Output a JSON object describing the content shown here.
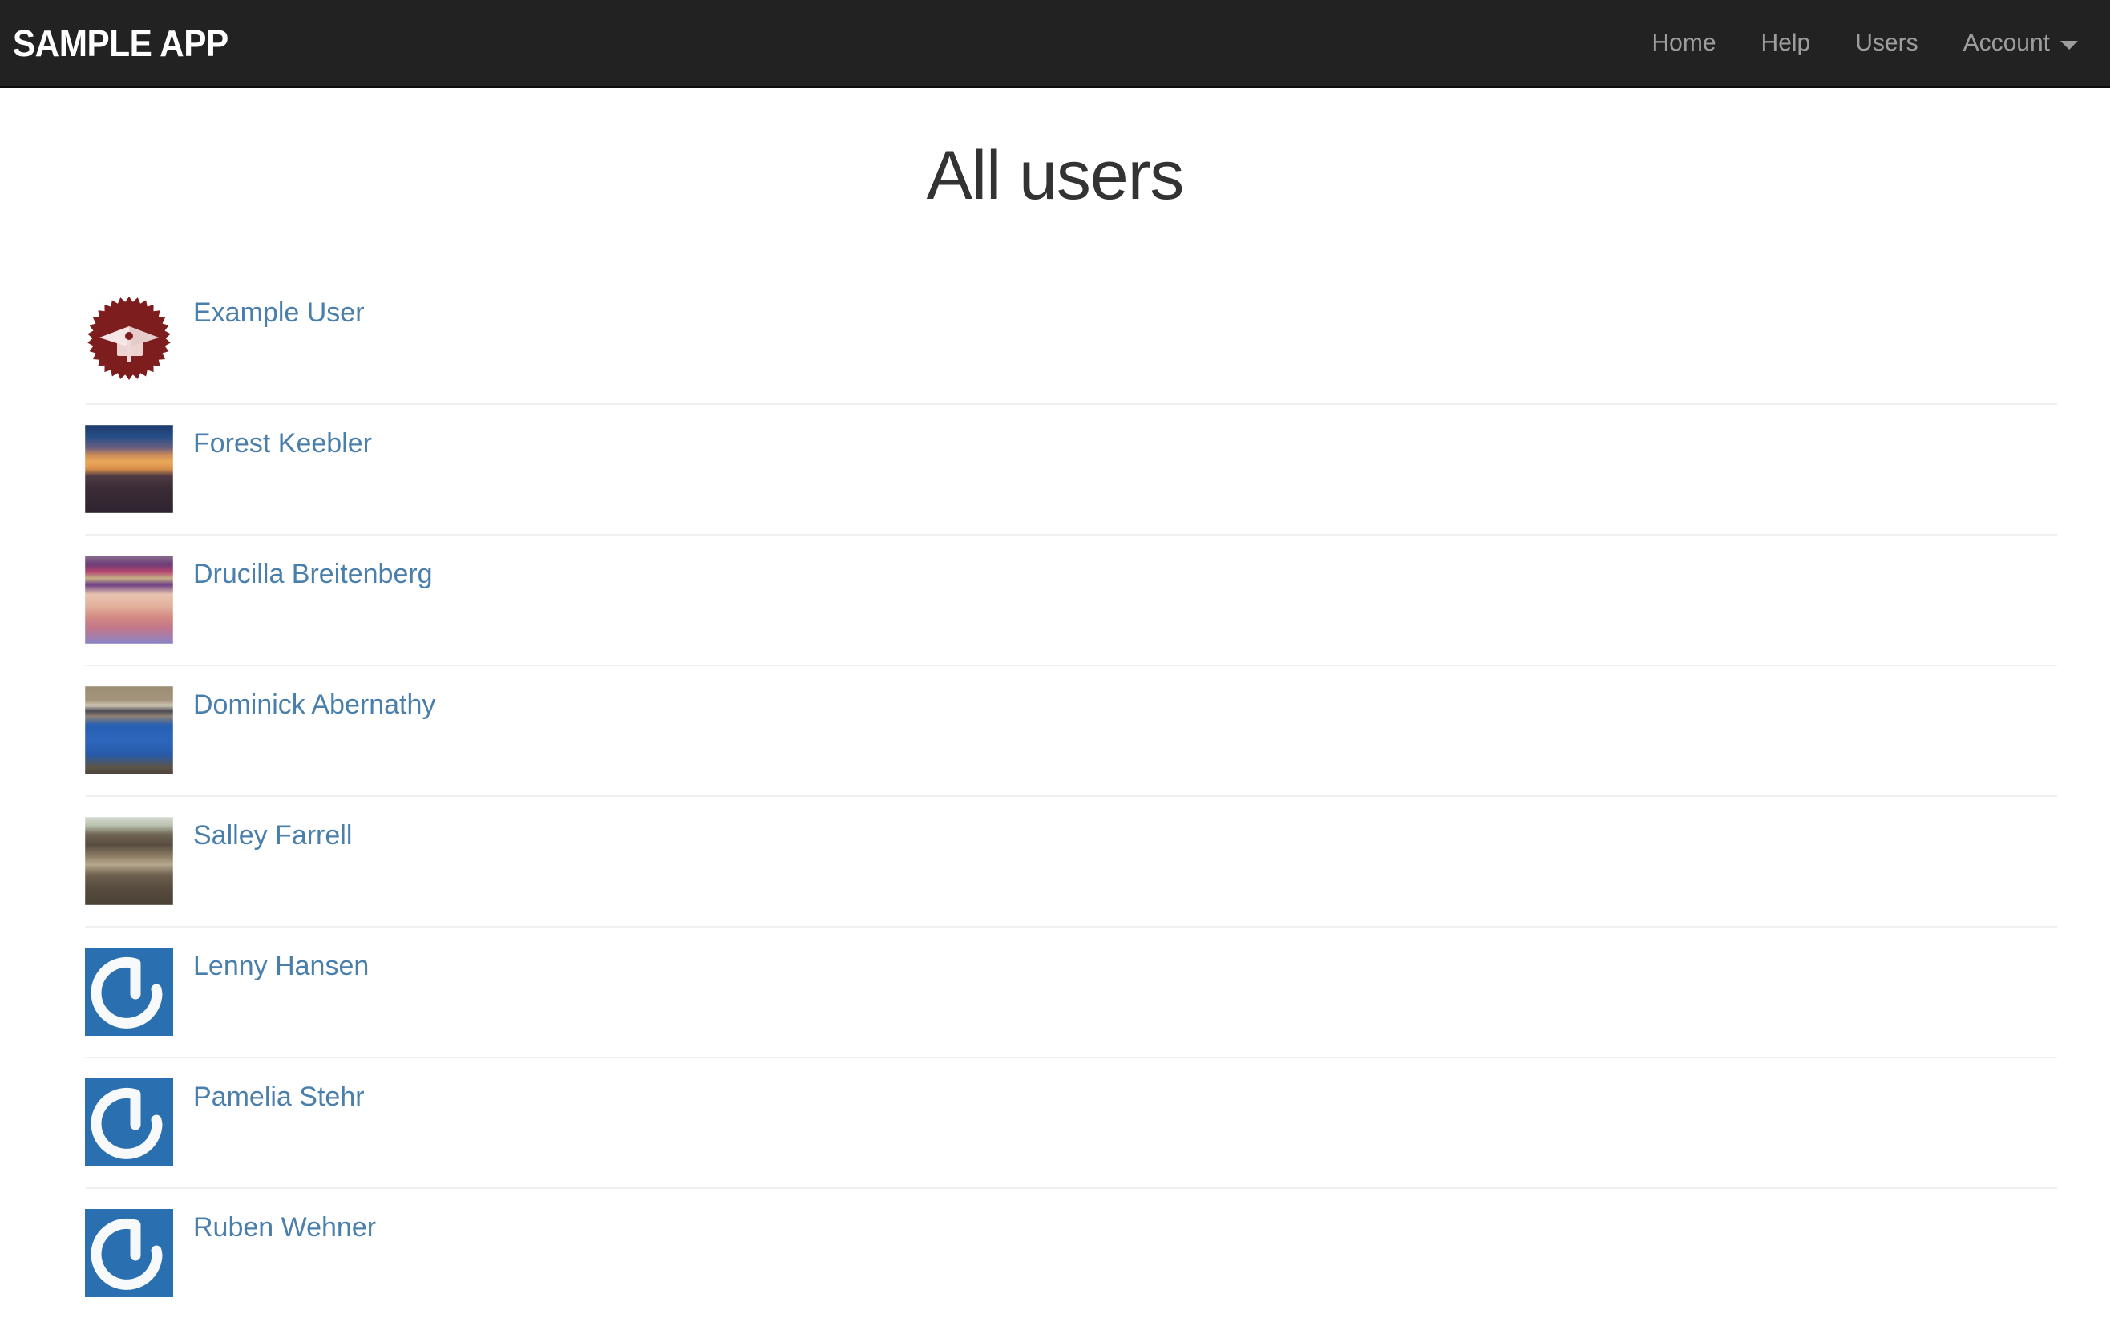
{
  "navbar": {
    "brand": "sample app",
    "links": [
      {
        "label": "Home",
        "name": "nav-link-home"
      },
      {
        "label": "Help",
        "name": "nav-link-help"
      },
      {
        "label": "Users",
        "name": "nav-link-users"
      }
    ],
    "account": {
      "label": "Account",
      "caret_icon": "chevron-down-icon"
    },
    "background_color": "#222222",
    "link_color": "#9d9d9d",
    "brand_color": "#ffffff"
  },
  "page": {
    "heading": "All users",
    "heading_color": "#333333",
    "link_color": "#4a7fac",
    "divider_color": "#f0f0f0"
  },
  "users": [
    {
      "name": "Example User",
      "avatar_icon": "graduation-cap-badge-avatar",
      "avatar_type": "rails-tutorial-badge"
    },
    {
      "name": "Forest Keebler",
      "avatar_icon": "sunset-landscape-photo-avatar",
      "avatar_type": "photo"
    },
    {
      "name": "Drucilla Breitenberg",
      "avatar_icon": "baby-in-knit-hat-photo-avatar",
      "avatar_type": "photo"
    },
    {
      "name": "Dominick Abernathy",
      "avatar_icon": "person-in-blue-shirt-photo-avatar",
      "avatar_type": "photo"
    },
    {
      "name": "Salley Farrell",
      "avatar_icon": "tabby-cat-photo-avatar",
      "avatar_type": "photo"
    },
    {
      "name": "Lenny Hansen",
      "avatar_icon": "gravatar-default-logo-avatar",
      "avatar_type": "gravatar-default"
    },
    {
      "name": "Pamelia Stehr",
      "avatar_icon": "gravatar-default-logo-avatar",
      "avatar_type": "gravatar-default"
    },
    {
      "name": "Ruben Wehner",
      "avatar_icon": "gravatar-default-logo-avatar",
      "avatar_type": "gravatar-default"
    }
  ]
}
